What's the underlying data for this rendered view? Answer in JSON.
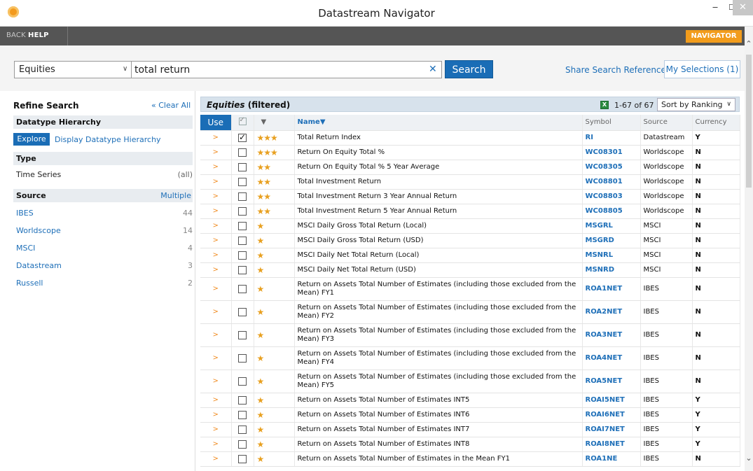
{
  "window": {
    "title": "Datastream Navigator"
  },
  "toolbar": {
    "back": "BACK",
    "help": "HELP",
    "badge": "NAVIGATOR"
  },
  "search": {
    "category": "Equities",
    "query": "total return",
    "button": "Search",
    "share": "Share Search Reference",
    "my_selections": "My Selections (1)"
  },
  "refine": {
    "title": "Refine Search",
    "clear_all": "Clear All",
    "datatype_hierarchy": "Datatype Hierarchy",
    "explore": "Explore",
    "display_hierarchy": "Display Datatype Hierarchy",
    "type_head": "Type",
    "type_value": "Time Series",
    "type_count": "(all)",
    "source_head": "Source",
    "source_multiple": "Multiple",
    "sources": [
      {
        "name": "IBES",
        "count": "44"
      },
      {
        "name": "Worldscope",
        "count": "14"
      },
      {
        "name": "MSCI",
        "count": "4"
      },
      {
        "name": "Datastream",
        "count": "3"
      },
      {
        "name": "Russell",
        "count": "2"
      }
    ]
  },
  "results": {
    "title_italic": "Equities",
    "title_rest": " (filtered)",
    "range": "1-67 of 67",
    "sort": "Sort by Ranking",
    "columns": {
      "use": "Use",
      "name": "Name",
      "symbol": "Symbol",
      "source": "Source",
      "currency": "Currency"
    },
    "rows": [
      {
        "checked": true,
        "stars": "☆☆☆",
        "name": "Total Return Index",
        "symbol": "RI",
        "source": "Datastream",
        "currency": "Y"
      },
      {
        "checked": false,
        "stars": "☆☆☆",
        "name": "Return On Equity Total %",
        "symbol": "WC08301",
        "source": "Worldscope",
        "currency": "N"
      },
      {
        "checked": false,
        "stars": "☆☆",
        "name": "Return On Equity Total % 5 Year Average",
        "symbol": "WC08305",
        "source": "Worldscope",
        "currency": "N"
      },
      {
        "checked": false,
        "stars": "☆☆",
        "name": "Total Investment Return",
        "symbol": "WC08801",
        "source": "Worldscope",
        "currency": "N"
      },
      {
        "checked": false,
        "stars": "☆☆",
        "name": "Total Investment Return 3 Year Annual Return",
        "symbol": "WC08803",
        "source": "Worldscope",
        "currency": "N"
      },
      {
        "checked": false,
        "stars": "☆☆",
        "name": "Total Investment Return 5 Year Annual Return",
        "symbol": "WC08805",
        "source": "Worldscope",
        "currency": "N"
      },
      {
        "checked": false,
        "stars": "☆",
        "name": "MSCI Daily Gross Total Return (Local)",
        "symbol": "MSGRL",
        "source": "MSCI",
        "currency": "N"
      },
      {
        "checked": false,
        "stars": "☆",
        "name": "MSCI Daily Gross Total Return (USD)",
        "symbol": "MSGRD",
        "source": "MSCI",
        "currency": "N"
      },
      {
        "checked": false,
        "stars": "☆",
        "name": "MSCI Daily Net Total Return (Local)",
        "symbol": "MSNRL",
        "source": "MSCI",
        "currency": "N"
      },
      {
        "checked": false,
        "stars": "☆",
        "name": "MSCI Daily Net Total Return (USD)",
        "symbol": "MSNRD",
        "source": "MSCI",
        "currency": "N"
      },
      {
        "checked": false,
        "stars": "☆",
        "name": "Return on Assets Total Number of Estimates (including those excluded from the Mean) FY1",
        "symbol": "ROA1NET",
        "source": "IBES",
        "currency": "N",
        "tall": true
      },
      {
        "checked": false,
        "stars": "☆",
        "name": "Return on Assets Total Number of Estimates (including those excluded from the Mean) FY2",
        "symbol": "ROA2NET",
        "source": "IBES",
        "currency": "N",
        "tall": true
      },
      {
        "checked": false,
        "stars": "☆",
        "name": "Return on Assets Total Number of Estimates (including those excluded from the Mean) FY3",
        "symbol": "ROA3NET",
        "source": "IBES",
        "currency": "N",
        "tall": true
      },
      {
        "checked": false,
        "stars": "☆",
        "name": "Return on Assets Total Number of Estimates (including those excluded from the Mean) FY4",
        "symbol": "ROA4NET",
        "source": "IBES",
        "currency": "N",
        "tall": true
      },
      {
        "checked": false,
        "stars": "☆",
        "name": "Return on Assets Total Number of Estimates (including those excluded from the Mean) FY5",
        "symbol": "ROA5NET",
        "source": "IBES",
        "currency": "N",
        "tall": true
      },
      {
        "checked": false,
        "stars": "☆",
        "name": "Return on Assets Total Number of Estimates INT5",
        "symbol": "ROAI5NET",
        "source": "IBES",
        "currency": "Y"
      },
      {
        "checked": false,
        "stars": "☆",
        "name": "Return on Assets Total Number of Estimates INT6",
        "symbol": "ROAI6NET",
        "source": "IBES",
        "currency": "Y"
      },
      {
        "checked": false,
        "stars": "☆",
        "name": "Return on Assets Total Number of Estimates INT7",
        "symbol": "ROAI7NET",
        "source": "IBES",
        "currency": "Y"
      },
      {
        "checked": false,
        "stars": "☆",
        "name": "Return on Assets Total Number of Estimates INT8",
        "symbol": "ROAI8NET",
        "source": "IBES",
        "currency": "Y"
      },
      {
        "checked": false,
        "stars": "☆",
        "name": "Return on Assets Total Number of Estimates in the Mean FY1",
        "symbol": "ROA1NE",
        "source": "IBES",
        "currency": "N"
      }
    ]
  },
  "colors": {
    "accent": "#1a6db6",
    "badge": "#f29c1c",
    "star": "#e8a020"
  }
}
